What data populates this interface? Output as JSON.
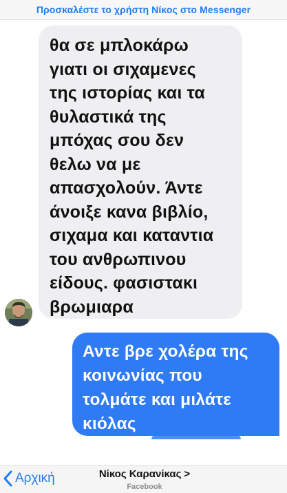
{
  "header": {
    "invite_text": "Προσκαλέστε το χρήστη Νίκος στο Messenger"
  },
  "messages": [
    {
      "direction": "incoming",
      "text": "θα σε μπλοκάρω\nγιατι οι σιχαμενες\nτης ιστορίας και τα\nθυλαστικά της\nμπόχας σου δεν\nθελω να με\nαπασχολούν. Άντε\nάνοιξε κανα βιβλίο,\nσιχαμα και καταντια\nτου ανθρωπινου\nείδους. φασιστακι\nβρωμιαρα"
    },
    {
      "direction": "outgoing",
      "text": "Αντε βρε χολέρα της\nκοινωνίας που\nτολμάτε και μιλάτε\nκιόλας"
    }
  ],
  "bottom_bar": {
    "back_label": "Αρχική",
    "contact_name": "Νίκος Καρανίκας",
    "contact_chevron": ">",
    "contact_subtitle": "Facebook"
  },
  "colors": {
    "accent": "#1f7cf2",
    "outgoing_bubble": "#2f7bf3",
    "incoming_bubble": "#efeff2"
  },
  "icons": {
    "back": "chevron-left-icon",
    "avatar": "user-avatar"
  }
}
